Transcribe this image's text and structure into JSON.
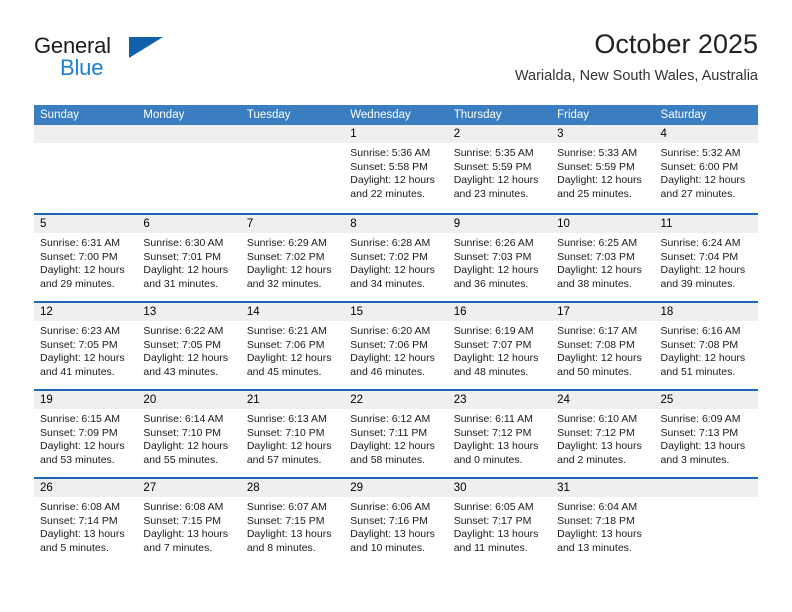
{
  "brand": {
    "name_part1": "General",
    "name_part2": "Blue",
    "triangle_icon": "brand-triangle-icon",
    "accent_color": "#1c7fd4",
    "triangle_color": "#1161aa"
  },
  "header": {
    "month_title": "October 2025",
    "location": "Warialda, New South Wales, Australia"
  },
  "colors": {
    "header_row_background": "#3a7dc0",
    "week_separator": "#1e68b3",
    "date_band_background": "#efefef",
    "page_background": "#ffffff",
    "text": "#1a1a1a"
  },
  "weekdays": [
    "Sunday",
    "Monday",
    "Tuesday",
    "Wednesday",
    "Thursday",
    "Friday",
    "Saturday"
  ],
  "weeks": [
    [
      {
        "day": "",
        "empty": true
      },
      {
        "day": "",
        "empty": true
      },
      {
        "day": "",
        "empty": true
      },
      {
        "day": "1",
        "sunrise": "Sunrise: 5:36 AM",
        "sunset": "Sunset: 5:58 PM",
        "daylight": "Daylight: 12 hours and 22 minutes."
      },
      {
        "day": "2",
        "sunrise": "Sunrise: 5:35 AM",
        "sunset": "Sunset: 5:59 PM",
        "daylight": "Daylight: 12 hours and 23 minutes."
      },
      {
        "day": "3",
        "sunrise": "Sunrise: 5:33 AM",
        "sunset": "Sunset: 5:59 PM",
        "daylight": "Daylight: 12 hours and 25 minutes."
      },
      {
        "day": "4",
        "sunrise": "Sunrise: 5:32 AM",
        "sunset": "Sunset: 6:00 PM",
        "daylight": "Daylight: 12 hours and 27 minutes."
      }
    ],
    [
      {
        "day": "5",
        "sunrise": "Sunrise: 6:31 AM",
        "sunset": "Sunset: 7:00 PM",
        "daylight": "Daylight: 12 hours and 29 minutes."
      },
      {
        "day": "6",
        "sunrise": "Sunrise: 6:30 AM",
        "sunset": "Sunset: 7:01 PM",
        "daylight": "Daylight: 12 hours and 31 minutes."
      },
      {
        "day": "7",
        "sunrise": "Sunrise: 6:29 AM",
        "sunset": "Sunset: 7:02 PM",
        "daylight": "Daylight: 12 hours and 32 minutes."
      },
      {
        "day": "8",
        "sunrise": "Sunrise: 6:28 AM",
        "sunset": "Sunset: 7:02 PM",
        "daylight": "Daylight: 12 hours and 34 minutes."
      },
      {
        "day": "9",
        "sunrise": "Sunrise: 6:26 AM",
        "sunset": "Sunset: 7:03 PM",
        "daylight": "Daylight: 12 hours and 36 minutes."
      },
      {
        "day": "10",
        "sunrise": "Sunrise: 6:25 AM",
        "sunset": "Sunset: 7:03 PM",
        "daylight": "Daylight: 12 hours and 38 minutes."
      },
      {
        "day": "11",
        "sunrise": "Sunrise: 6:24 AM",
        "sunset": "Sunset: 7:04 PM",
        "daylight": "Daylight: 12 hours and 39 minutes."
      }
    ],
    [
      {
        "day": "12",
        "sunrise": "Sunrise: 6:23 AM",
        "sunset": "Sunset: 7:05 PM",
        "daylight": "Daylight: 12 hours and 41 minutes."
      },
      {
        "day": "13",
        "sunrise": "Sunrise: 6:22 AM",
        "sunset": "Sunset: 7:05 PM",
        "daylight": "Daylight: 12 hours and 43 minutes."
      },
      {
        "day": "14",
        "sunrise": "Sunrise: 6:21 AM",
        "sunset": "Sunset: 7:06 PM",
        "daylight": "Daylight: 12 hours and 45 minutes."
      },
      {
        "day": "15",
        "sunrise": "Sunrise: 6:20 AM",
        "sunset": "Sunset: 7:06 PM",
        "daylight": "Daylight: 12 hours and 46 minutes."
      },
      {
        "day": "16",
        "sunrise": "Sunrise: 6:19 AM",
        "sunset": "Sunset: 7:07 PM",
        "daylight": "Daylight: 12 hours and 48 minutes."
      },
      {
        "day": "17",
        "sunrise": "Sunrise: 6:17 AM",
        "sunset": "Sunset: 7:08 PM",
        "daylight": "Daylight: 12 hours and 50 minutes."
      },
      {
        "day": "18",
        "sunrise": "Sunrise: 6:16 AM",
        "sunset": "Sunset: 7:08 PM",
        "daylight": "Daylight: 12 hours and 51 minutes."
      }
    ],
    [
      {
        "day": "19",
        "sunrise": "Sunrise: 6:15 AM",
        "sunset": "Sunset: 7:09 PM",
        "daylight": "Daylight: 12 hours and 53 minutes."
      },
      {
        "day": "20",
        "sunrise": "Sunrise: 6:14 AM",
        "sunset": "Sunset: 7:10 PM",
        "daylight": "Daylight: 12 hours and 55 minutes."
      },
      {
        "day": "21",
        "sunrise": "Sunrise: 6:13 AM",
        "sunset": "Sunset: 7:10 PM",
        "daylight": "Daylight: 12 hours and 57 minutes."
      },
      {
        "day": "22",
        "sunrise": "Sunrise: 6:12 AM",
        "sunset": "Sunset: 7:11 PM",
        "daylight": "Daylight: 12 hours and 58 minutes."
      },
      {
        "day": "23",
        "sunrise": "Sunrise: 6:11 AM",
        "sunset": "Sunset: 7:12 PM",
        "daylight": "Daylight: 13 hours and 0 minutes."
      },
      {
        "day": "24",
        "sunrise": "Sunrise: 6:10 AM",
        "sunset": "Sunset: 7:12 PM",
        "daylight": "Daylight: 13 hours and 2 minutes."
      },
      {
        "day": "25",
        "sunrise": "Sunrise: 6:09 AM",
        "sunset": "Sunset: 7:13 PM",
        "daylight": "Daylight: 13 hours and 3 minutes."
      }
    ],
    [
      {
        "day": "26",
        "sunrise": "Sunrise: 6:08 AM",
        "sunset": "Sunset: 7:14 PM",
        "daylight": "Daylight: 13 hours and 5 minutes."
      },
      {
        "day": "27",
        "sunrise": "Sunrise: 6:08 AM",
        "sunset": "Sunset: 7:15 PM",
        "daylight": "Daylight: 13 hours and 7 minutes."
      },
      {
        "day": "28",
        "sunrise": "Sunrise: 6:07 AM",
        "sunset": "Sunset: 7:15 PM",
        "daylight": "Daylight: 13 hours and 8 minutes."
      },
      {
        "day": "29",
        "sunrise": "Sunrise: 6:06 AM",
        "sunset": "Sunset: 7:16 PM",
        "daylight": "Daylight: 13 hours and 10 minutes."
      },
      {
        "day": "30",
        "sunrise": "Sunrise: 6:05 AM",
        "sunset": "Sunset: 7:17 PM",
        "daylight": "Daylight: 13 hours and 11 minutes."
      },
      {
        "day": "31",
        "sunrise": "Sunrise: 6:04 AM",
        "sunset": "Sunset: 7:18 PM",
        "daylight": "Daylight: 13 hours and 13 minutes."
      },
      {
        "day": "",
        "empty": true
      }
    ]
  ]
}
